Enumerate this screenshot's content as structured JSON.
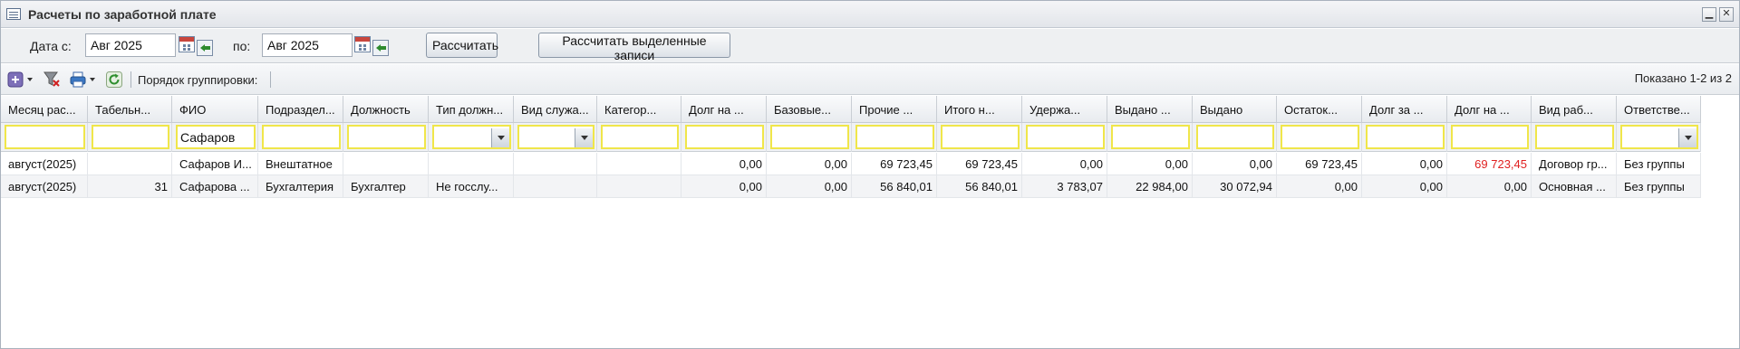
{
  "window": {
    "title": "Расчеты по заработной плате",
    "minimize_glyph": "▁",
    "close_glyph": "✕"
  },
  "filters": {
    "date_from_label": "Дата с:",
    "date_from_value": "Авг 2025",
    "date_to_label": "по:",
    "date_to_value": "Авг 2025",
    "calculate_label": "Рассчитать",
    "calculate_selected_label": "Рассчитать выделенные записи"
  },
  "toolbar": {
    "grouping_label": "Порядок группировки:",
    "shown_text": "Показано 1-2 из 2",
    "icons": [
      "add-icon",
      "clear-filter-icon",
      "print-icon",
      "refresh-icon"
    ]
  },
  "grid": {
    "columns": [
      "Месяц рас...",
      "Табельн...",
      "ФИО",
      "Подраздел...",
      "Должность",
      "Тип должн...",
      "Вид служа...",
      "Категор...",
      "Долг на ...",
      "Базовые...",
      "Прочие ...",
      "Итого н...",
      "Удержа...",
      "Выдано ...",
      "Выдано",
      "Остаток...",
      "Долг за ...",
      "Долг на ...",
      "Вид раб...",
      "Ответстве..."
    ],
    "column_filters": [
      "",
      "",
      "Сафаров",
      "",
      "",
      "",
      "",
      "",
      "",
      "",
      "",
      "",
      "",
      "",
      "",
      "",
      "",
      "",
      "",
      ""
    ],
    "rows": [
      [
        "август(2025)",
        "",
        "Сафаров И...",
        "Внештатное",
        "",
        "",
        "",
        "",
        "0,00",
        "0,00",
        "69 723,45",
        "69 723,45",
        "0,00",
        "0,00",
        "0,00",
        "69 723,45",
        "0,00",
        "69 723,45",
        "Договор гр...",
        "Без группы"
      ],
      [
        "август(2025)",
        "31",
        "Сафарова ...",
        "Бухгалтерия",
        "Бухгалтер",
        "Не госслу...",
        "",
        "",
        "0,00",
        "0,00",
        "56 840,01",
        "56 840,01",
        "3 783,07",
        "22 984,00",
        "30 072,94",
        "0,00",
        "0,00",
        "0,00",
        "Основная ...",
        "Без группы"
      ]
    ]
  },
  "colors": {
    "negative_value": "#e02020",
    "filter_highlight": "#f0e64a"
  }
}
